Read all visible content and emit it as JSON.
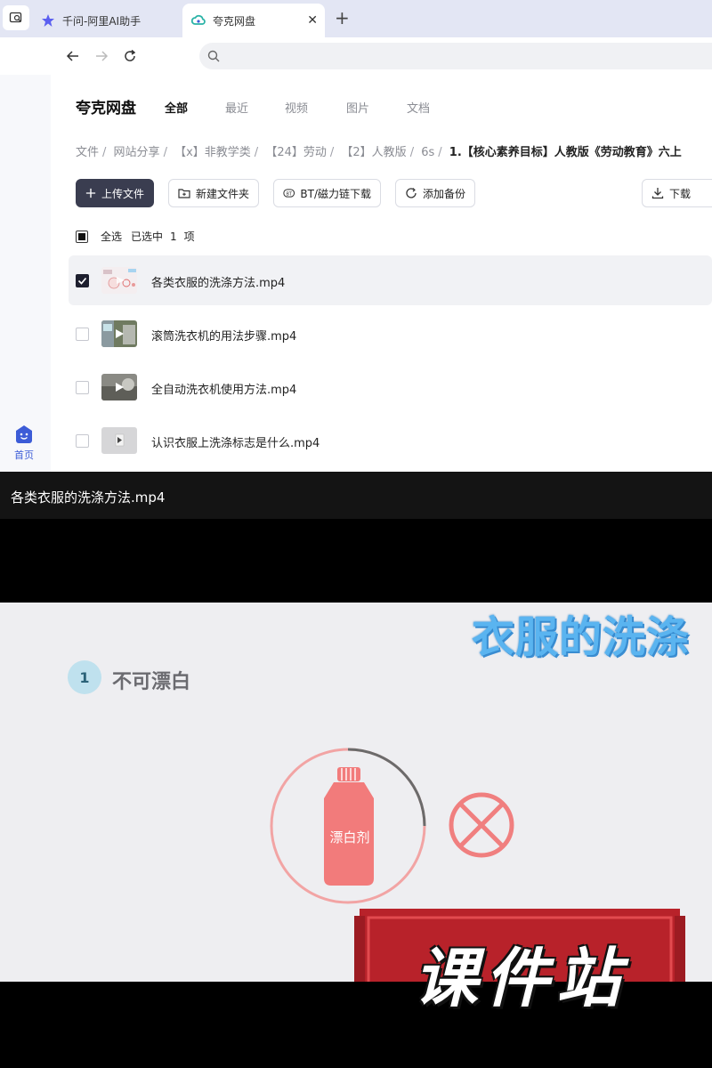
{
  "browser": {
    "tabs": [
      {
        "label": "千问-阿里AI助手",
        "icon": "qianwen-star-icon",
        "active": false
      },
      {
        "label": "夸克网盘",
        "icon": "quark-cloud-icon",
        "active": true
      }
    ],
    "address": {
      "value": ""
    }
  },
  "rail": {
    "home_label": "首页"
  },
  "app": {
    "brand": "夸克网盘",
    "categories": [
      "全部",
      "最近",
      "视频",
      "图片",
      "文档"
    ],
    "breadcrumb": [
      "文件",
      "网站分享",
      "【x】非教学类",
      "【24】劳动",
      "【2】人教版",
      "6s",
      "1.【核心素养目标】人教版《劳动教育》六上"
    ],
    "actions": {
      "upload": "上传文件",
      "new_folder": "新建文件夹",
      "bt_download": "BT/磁力链下载",
      "add_backup": "添加备份",
      "download": "下载"
    },
    "selection": {
      "select_all": "全选",
      "selected_prefix": "已选中",
      "count": "1",
      "unit": "项"
    },
    "files": [
      {
        "name": "各类衣服的洗涤方法.mp4",
        "selected": true
      },
      {
        "name": "滚筒洗衣机的用法步骤.mp4",
        "selected": false
      },
      {
        "name": "全自动洗衣机使用方法.mp4",
        "selected": false
      },
      {
        "name": "认识衣服上洗涤标志是什么.mp4",
        "selected": false
      }
    ]
  },
  "player": {
    "title": "各类衣服的洗涤方法.mp4",
    "video": {
      "heading": "衣服的洗涤",
      "step_number": "1",
      "step_label": "不可漂白",
      "bottle_label": "漂白剂",
      "watermark": "课件站"
    }
  },
  "colors": {
    "primary_button": "#3a3d50",
    "accent_blue": "#3c5cd7",
    "tabstrip": "#e3e6f4",
    "video_heading": "#5ab4f0",
    "bleach_red": "#f08080",
    "watermark_red": "#b8222a"
  }
}
